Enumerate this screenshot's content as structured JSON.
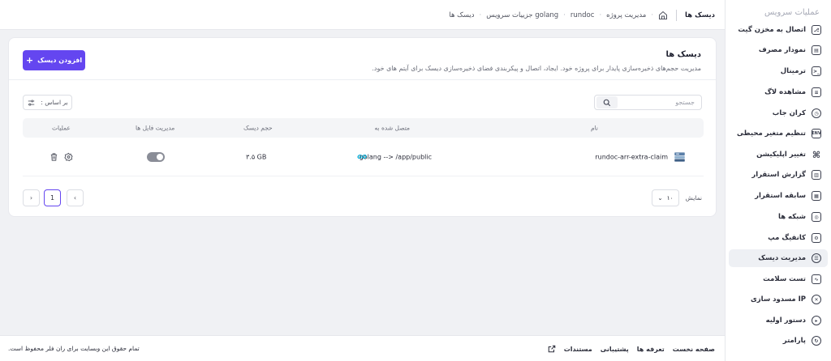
{
  "sidebar": {
    "title": "عملیات سرویس",
    "items": [
      {
        "label": "اتصال به مخزن گیت",
        "icon": "git-icon"
      },
      {
        "label": "نمودار مصرف",
        "icon": "chart-icon"
      },
      {
        "label": "ترمینال",
        "icon": "terminal-icon"
      },
      {
        "label": "مشاهده لاگ",
        "icon": "log-icon"
      },
      {
        "label": "کران جاب",
        "icon": "cron-icon"
      },
      {
        "label": "تنظیم متغیر محیطی",
        "icon": "env-icon"
      },
      {
        "label": "تغییر اپلیکیشن",
        "icon": "app-change-icon"
      },
      {
        "label": "گزارش استقرار",
        "icon": "report-icon"
      },
      {
        "label": "سابقه استقرار",
        "icon": "history-icon"
      },
      {
        "label": "شبکه ها",
        "icon": "network-icon"
      },
      {
        "label": "کانفیگ مپ",
        "icon": "configmap-icon"
      },
      {
        "label": "مدیریت دیسک",
        "icon": "disk-icon"
      },
      {
        "label": "تست سلامت",
        "icon": "health-icon"
      },
      {
        "label": "مسدود سازی IP",
        "icon": "block-ip-icon"
      },
      {
        "label": "دستور اولیه",
        "icon": "command-icon"
      },
      {
        "label": "پارامتر",
        "icon": "parameter-icon"
      }
    ]
  },
  "breadcrumb": {
    "current": "دیسک ها",
    "items": [
      "مدیریت پروژه",
      "rundoc",
      "جزییات سرویس golang",
      "دیسک ها"
    ]
  },
  "card": {
    "title": "دیسک ها",
    "description": "مدیریت حجم‌های ذخیره‌سازی پایدار برای پروژه خود. ایجاد، اتصال و پیکربندی فضای ذخیره‌سازی دیسک برای آیتم های خود.",
    "add_button": "افزودن دیسک",
    "search_placeholder": "جستجو",
    "sort_label": "بر اساس :"
  },
  "table": {
    "headers": {
      "name": "نام",
      "attached": "متصل شده به",
      "size": "حجم دیسک",
      "file_manager": "مدیریت فایل ها",
      "actions": "عملیات"
    },
    "rows": [
      {
        "name": "rundoc-arr-extra-claim",
        "attached": "golang --> /app/public",
        "size": "۳.۵ GB",
        "file_manager_enabled": false
      }
    ]
  },
  "pagination": {
    "current_page": "1",
    "show_label": "نمایش",
    "per_page": "۱۰"
  },
  "footer": {
    "links": [
      "صفحه نخست",
      "تعرفه ها",
      "پشتیبانی",
      "مستندات"
    ],
    "copyright": "تمام حقوق این وبسایت برای ران فلر محفوظ است."
  },
  "colors": {
    "accent": "#6446f0",
    "go_brand": "#00acd7"
  }
}
